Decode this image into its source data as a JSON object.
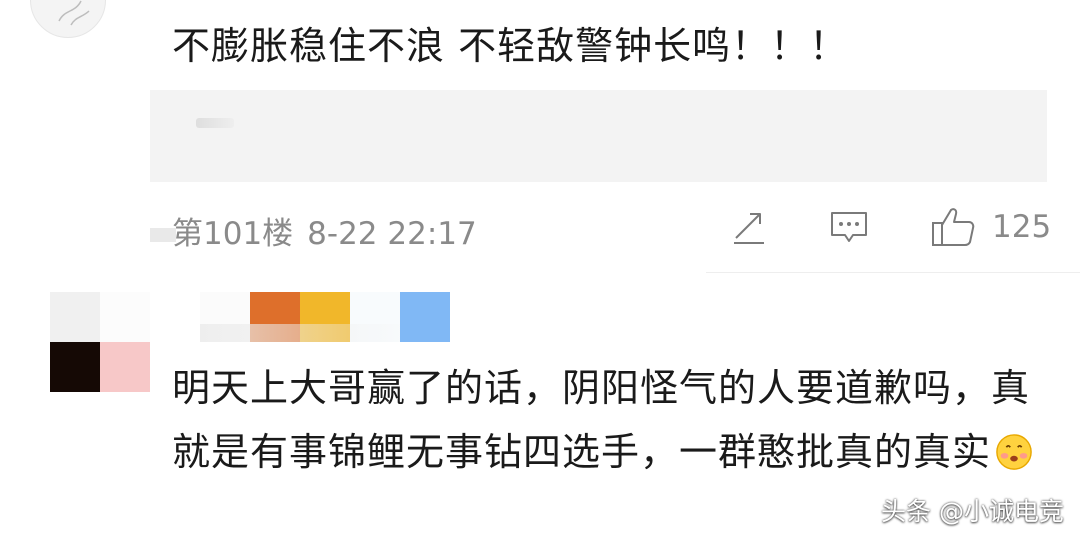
{
  "comment_1": {
    "text": "不膨胀稳住不浪 不轻敌警钟长鸣！！！",
    "floor": "第101楼",
    "timestamp": "8-22 22:17",
    "like_count": "125",
    "icons": [
      "share-icon",
      "reply-icon",
      "like-icon"
    ]
  },
  "comment_2": {
    "avatar_tiles": [
      "#f0f0f0",
      "#fcfcfc",
      "#150905",
      "#f7c8c8"
    ],
    "name_tiles": [
      "#fbfbfb",
      "#de6f2b",
      "#f1b72a",
      "#f8fbfd",
      "#80b8f5"
    ],
    "text": "明天上大哥赢了的话，阴阳怪气的人要道歉吗，真就是有事锦鲤无事钻四选手，一群憨批真的真实",
    "emoji": "blush-emoji"
  },
  "watermark": "头条 @小诚电竞"
}
